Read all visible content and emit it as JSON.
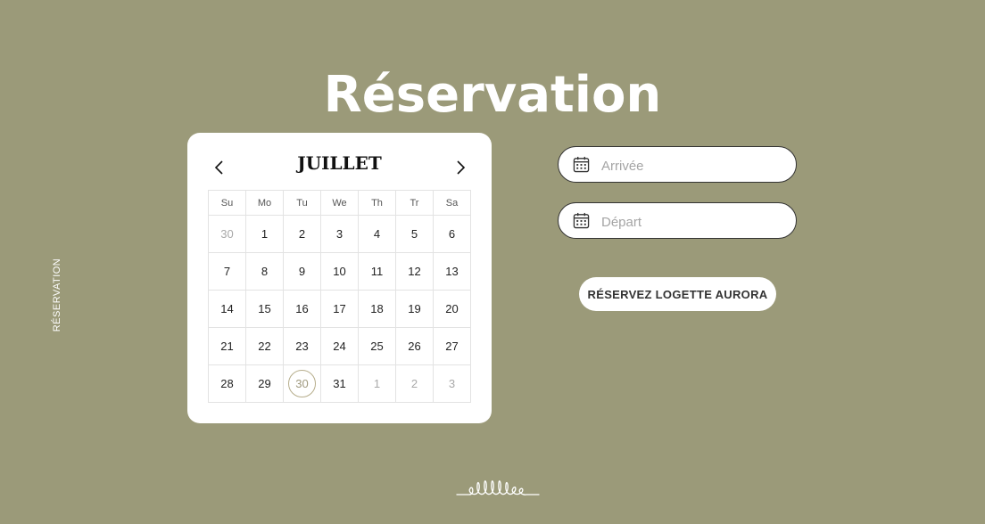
{
  "page": {
    "title": "Réservation",
    "side_label": "RÉSERVATION"
  },
  "calendar": {
    "month": "JUILLET",
    "weekdays": [
      "Su",
      "Mo",
      "Tu",
      "We",
      "Th",
      "Tr",
      "Sa"
    ],
    "weeks": [
      [
        {
          "d": "30",
          "muted": true
        },
        {
          "d": "1"
        },
        {
          "d": "2"
        },
        {
          "d": "3"
        },
        {
          "d": "4"
        },
        {
          "d": "5"
        },
        {
          "d": "6"
        }
      ],
      [
        {
          "d": "7"
        },
        {
          "d": "8"
        },
        {
          "d": "9"
        },
        {
          "d": "10"
        },
        {
          "d": "11"
        },
        {
          "d": "12"
        },
        {
          "d": "13"
        }
      ],
      [
        {
          "d": "14"
        },
        {
          "d": "15"
        },
        {
          "d": "16"
        },
        {
          "d": "17"
        },
        {
          "d": "18"
        },
        {
          "d": "19"
        },
        {
          "d": "20"
        }
      ],
      [
        {
          "d": "21"
        },
        {
          "d": "22"
        },
        {
          "d": "23"
        },
        {
          "d": "24"
        },
        {
          "d": "25"
        },
        {
          "d": "26"
        },
        {
          "d": "27"
        }
      ],
      [
        {
          "d": "28"
        },
        {
          "d": "29"
        },
        {
          "d": "30",
          "selected": true
        },
        {
          "d": "31"
        },
        {
          "d": "1",
          "muted": true
        },
        {
          "d": "2",
          "muted": true
        },
        {
          "d": "3",
          "muted": true
        }
      ]
    ],
    "prev_icon": "chevron-left-icon",
    "next_icon": "chevron-right-icon"
  },
  "form": {
    "arrival": {
      "placeholder": "Arrivée",
      "value": "",
      "icon": "calendar-icon"
    },
    "departure": {
      "placeholder": "Départ",
      "value": "",
      "icon": "calendar-icon"
    },
    "submit_label": "RÉSERVEZ LOGETTE AURORA"
  },
  "colors": {
    "background": "#9b9a79",
    "accent": "#b6ad8b"
  }
}
